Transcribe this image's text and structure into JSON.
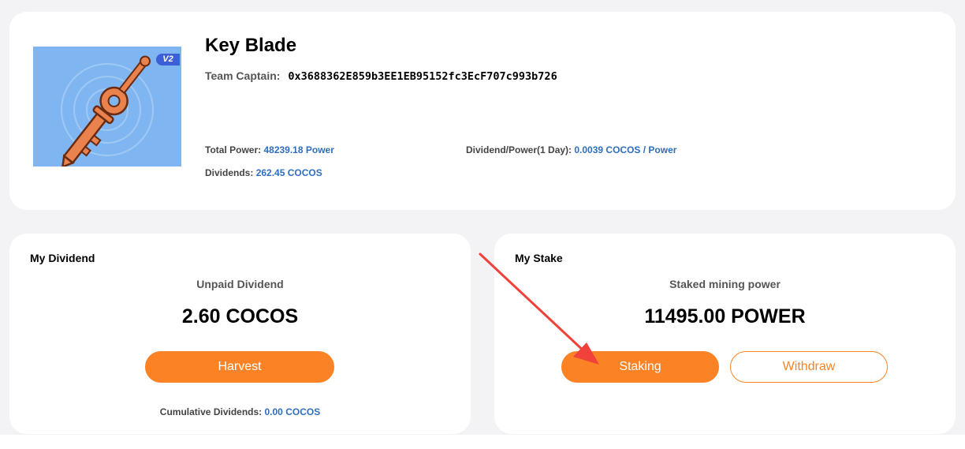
{
  "team": {
    "name": "Key Blade",
    "captain_label": "Team Captain:",
    "captain_address": "0x3688362E859b3EE1EB95152fc3EcF707c993b726",
    "badge": "V2",
    "total_power_label": "Total Power:",
    "total_power_value": "48239.18 Power",
    "dividends_label": "Dividends:",
    "dividends_value": "262.45 COCOS",
    "dividend_per_power_label": "Dividend/Power(1 Day):",
    "dividend_per_power_value": "0.0039 COCOS / Power"
  },
  "my_dividend": {
    "title": "My Dividend",
    "subtitle": "Unpaid Dividend",
    "amount": "2.60 COCOS",
    "harvest_label": "Harvest",
    "cumulative_label": "Cumulative Dividends:",
    "cumulative_value": "0.00 COCOS"
  },
  "my_stake": {
    "title": "My Stake",
    "subtitle": "Staked mining power",
    "amount": "11495.00 POWER",
    "staking_label": "Staking",
    "withdraw_label": "Withdraw"
  },
  "colors": {
    "accent": "#fb8326",
    "link": "#2e6ebf",
    "annotation": "#f0413a",
    "image_bg": "#7fb6f1"
  }
}
